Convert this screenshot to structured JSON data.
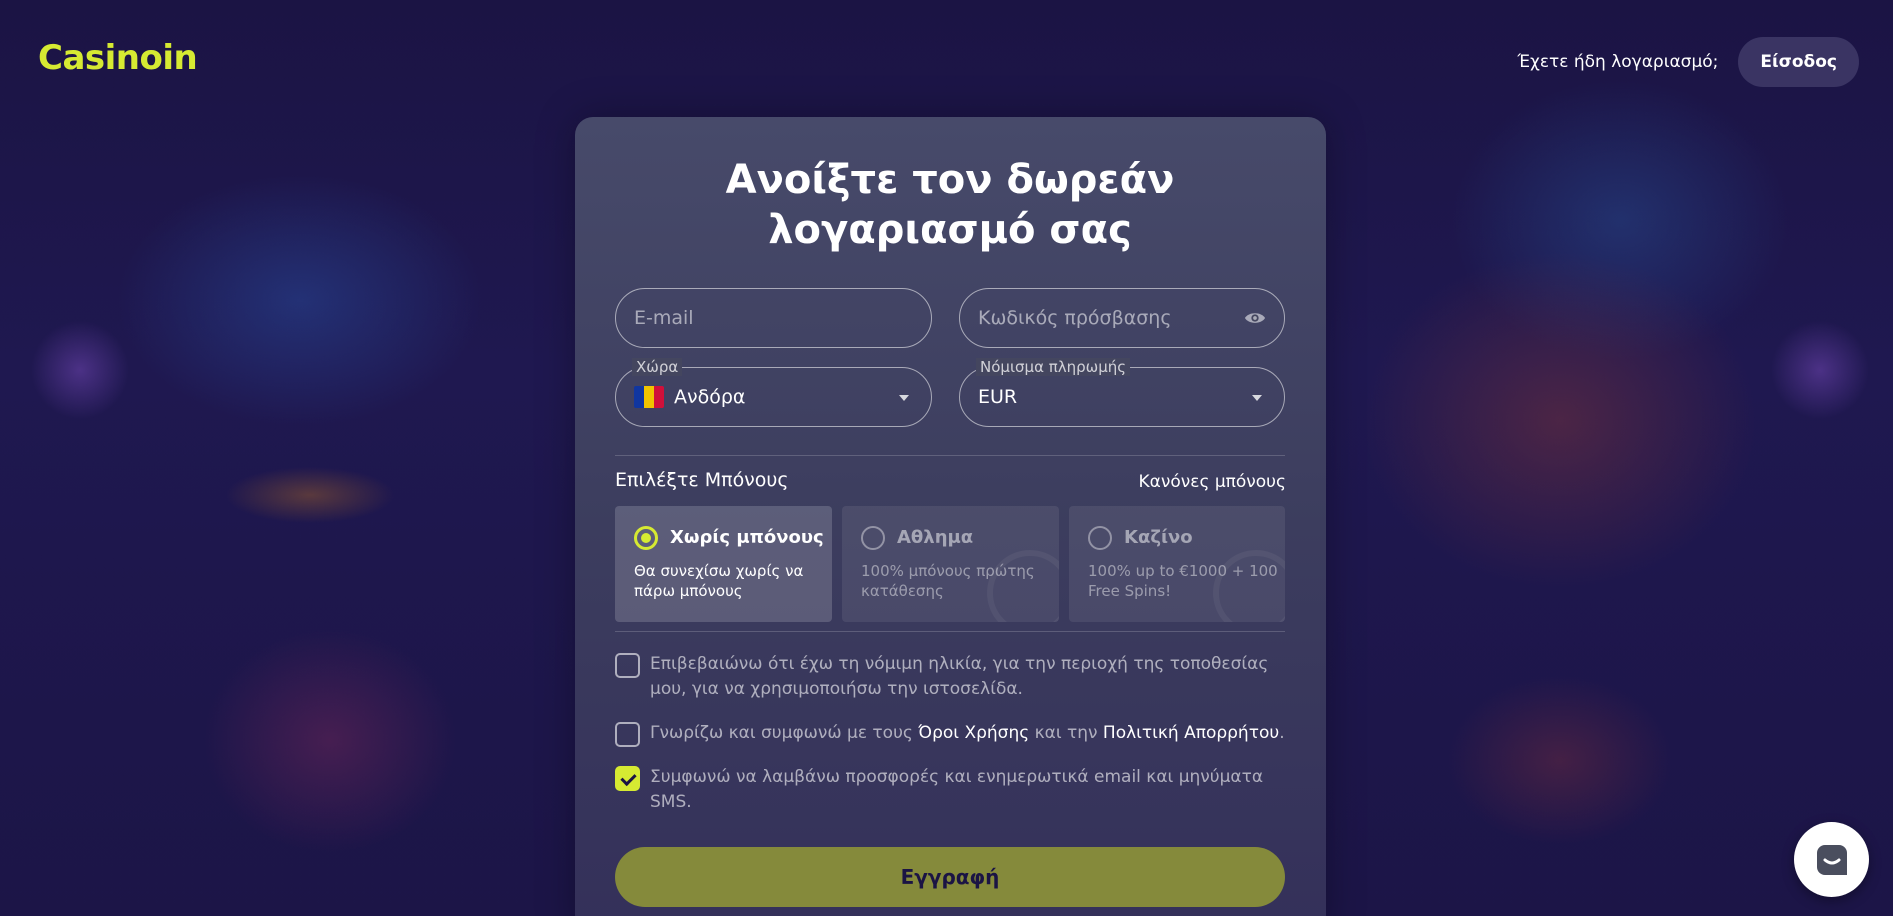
{
  "brand": {
    "logo_text": "Casinoin",
    "accent_color": "#d6ea32"
  },
  "header": {
    "have_account_text": "Έχετε ήδη λογαριασμό;",
    "login_label": "Είσοδος"
  },
  "form": {
    "title": "Ανοίξτε τον δωρεάν λογαριασμό σας",
    "email_placeholder": "E-mail",
    "password_placeholder": "Κωδικός πρόσβασης",
    "country": {
      "label": "Χώρα",
      "value": "Ανδόρα",
      "flag_icon": "andorra-flag-icon"
    },
    "currency": {
      "label": "Νόμισμα πληρωμής",
      "value": "EUR"
    },
    "bonus": {
      "heading": "Επιλέξτε Μπόνους",
      "rules_link": "Κανόνες μπόνους",
      "options": [
        {
          "title": "Χωρίς μπόνους",
          "description": "Θα συνεχίσω χωρίς να πάρω μπόνους",
          "selected": true
        },
        {
          "title": "Αθλημα",
          "description": "100% μπόνους πρώτης κατάθεσης",
          "selected": false
        },
        {
          "title": "Καζίνο",
          "description": "100% up to €1000 + 100 Free Spins!",
          "selected": false
        }
      ]
    },
    "consents": [
      {
        "text": "Επιβεβαιώνω ότι έχω τη νόμιμη ηλικία, για την περιοχή της τοποθεσίας μου, για να χρησιμοποιήσω την ιστοσελίδα.",
        "checked": false
      },
      {
        "prefix": "Γνωρίζω και συμφωνώ με τους ",
        "terms_link": "Όροι Χρήσης",
        "middle": " και την ",
        "privacy_link": "Πολιτική Απορρήτου",
        "suffix": ".",
        "checked": false
      },
      {
        "text": "Συμφωνώ να λαμβάνω προσφορές και ενημερωτικά email και μηνύματα SMS.",
        "checked": true
      }
    ],
    "submit_label": "Εγγραφή"
  },
  "chat_widget": {
    "icon": "chat-icon"
  }
}
